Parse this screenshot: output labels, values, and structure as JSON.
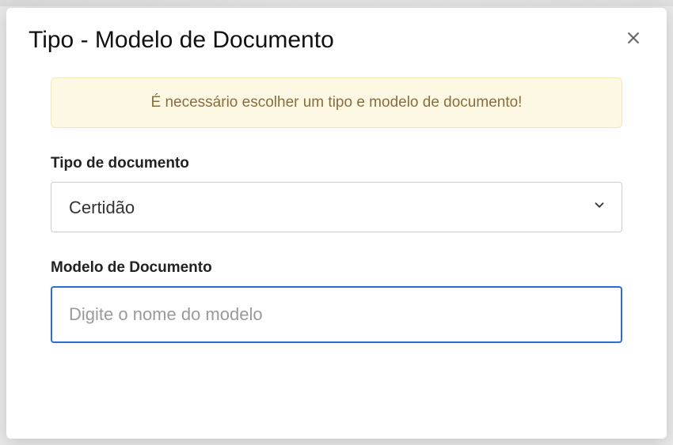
{
  "modal": {
    "title": "Tipo - Modelo de Documento",
    "alert": "É necessário escolher um tipo e modelo de documento!",
    "fields": {
      "tipo": {
        "label": "Tipo de documento",
        "value": "Certidão"
      },
      "modelo": {
        "label": "Modelo de Documento",
        "placeholder": "Digite o nome do modelo",
        "value": ""
      }
    }
  }
}
